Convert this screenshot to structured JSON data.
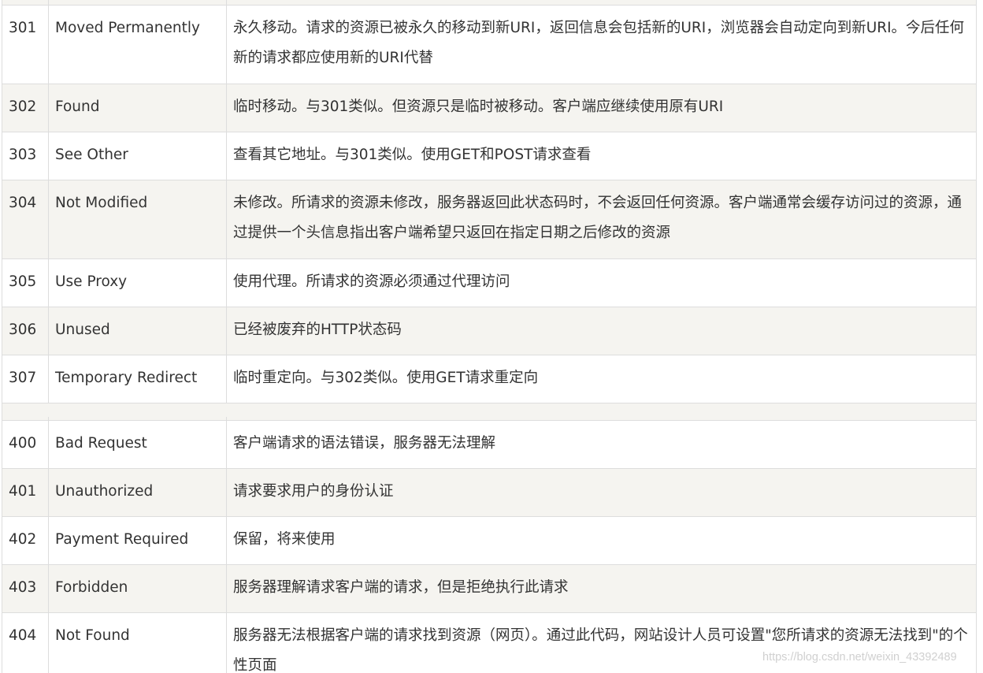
{
  "rows": [
    {
      "code": "301",
      "name": "Moved Permanently",
      "desc": "永久移动。请求的资源已被永久的移动到新URI，返回信息会包括新的URI，浏览器会自动定向到新URI。今后任何新的请求都应使用新的URI代替"
    },
    {
      "code": "302",
      "name": "Found",
      "desc": "临时移动。与301类似。但资源只是临时被移动。客户端应继续使用原有URI"
    },
    {
      "code": "303",
      "name": "See Other",
      "desc": "查看其它地址。与301类似。使用GET和POST请求查看"
    },
    {
      "code": "304",
      "name": "Not Modified",
      "desc": "未修改。所请求的资源未修改，服务器返回此状态码时，不会返回任何资源。客户端通常会缓存访问过的资源，通过提供一个头信息指出客户端希望只返回在指定日期之后修改的资源"
    },
    {
      "code": "305",
      "name": "Use Proxy",
      "desc": "使用代理。所请求的资源必须通过代理访问"
    },
    {
      "code": "306",
      "name": "Unused",
      "desc": "已经被废弃的HTTP状态码"
    },
    {
      "code": "307",
      "name": "Temporary Redirect",
      "desc": "临时重定向。与302类似。使用GET请求重定向"
    },
    {
      "code": "400",
      "name": "Bad Request",
      "desc": "客户端请求的语法错误，服务器无法理解"
    },
    {
      "code": "401",
      "name": "Unauthorized",
      "desc": "请求要求用户的身份认证"
    },
    {
      "code": "402",
      "name": "Payment Required",
      "desc": "保留，将来使用"
    },
    {
      "code": "403",
      "name": "Forbidden",
      "desc": "服务器理解请求客户端的请求，但是拒绝执行此请求"
    },
    {
      "code": "404",
      "name": "Not Found",
      "desc": "服务器无法根据客户端的请求找到资源（网页）。通过此代码，网站设计人员可设置\"您所请求的资源无法找到\"的个性页面"
    }
  ],
  "watermark": "https://blog.csdn.net/weixin_43392489"
}
